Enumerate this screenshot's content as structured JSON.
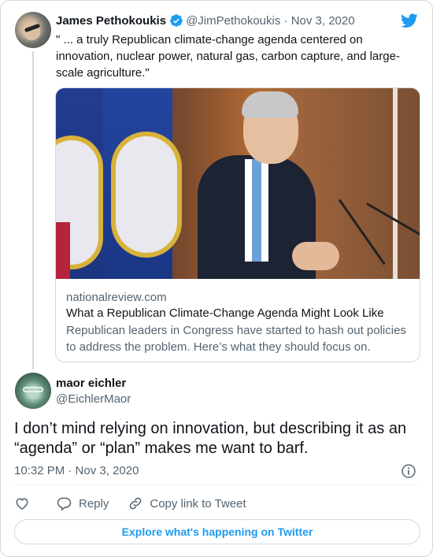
{
  "parent_tweet": {
    "name": "James Pethokoukis",
    "handle": "@JimPethokoukis",
    "separator": "·",
    "date": "Nov 3, 2020",
    "text": "\" ... a truly Republican climate-change agenda centered on innovation, nuclear power, natural gas, carbon capture, and large-scale agriculture.\"",
    "verified": true
  },
  "link_card": {
    "domain": "nationalreview.com",
    "title": "What a Republican Climate-Change Agenda Might Look Like",
    "description": "Republican leaders in Congress have started to hash out policies to address the problem. Here’s what they should focus on."
  },
  "reply_tweet": {
    "name": "maor eichler",
    "handle": "@EichlerMaor",
    "text": "I don’t mind relying on innovation, but describing it as an “agenda” or “plan” makes me want to barf.",
    "timestamp": "10:32 PM · Nov 3, 2020"
  },
  "actions": {
    "reply_label": "Reply",
    "copy_link_label": "Copy link to Tweet"
  },
  "explore_button": "Explore what's happening on Twitter",
  "colors": {
    "accent": "#1d9bf0",
    "text_primary": "#0f1419",
    "text_secondary": "#536471",
    "border": "#cfd9de"
  },
  "icons": [
    "verified-badge-icon",
    "twitter-bird-icon",
    "info-icon",
    "heart-icon",
    "reply-icon",
    "link-icon"
  ]
}
